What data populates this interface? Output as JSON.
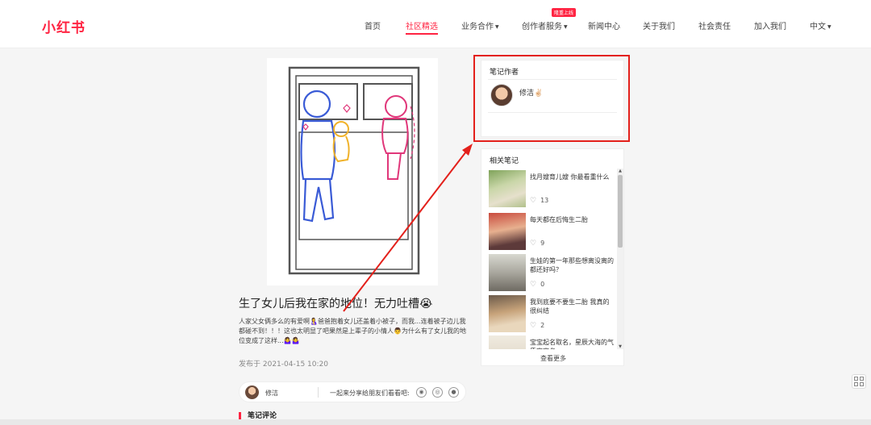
{
  "header": {
    "logo": "小红书",
    "nav": [
      {
        "label": "首页",
        "caret": false,
        "active": false
      },
      {
        "label": "社区精选",
        "caret": false,
        "active": true
      },
      {
        "label": "业务合作",
        "caret": true,
        "active": false
      },
      {
        "label": "创作者服务",
        "caret": true,
        "active": false
      },
      {
        "label": "新闻中心",
        "caret": false,
        "active": false
      },
      {
        "label": "关于我们",
        "caret": false,
        "active": false
      },
      {
        "label": "社会责任",
        "caret": false,
        "active": false
      },
      {
        "label": "加入我们",
        "caret": false,
        "active": false
      },
      {
        "label": "中文",
        "caret": true,
        "active": false
      }
    ],
    "badge": "隆重上线",
    "accent_color": "#ff2442"
  },
  "post": {
    "title": "生了女儿后我在家的地位！无力吐槽😭",
    "body": "人家父女俩多么的有爱啊🤱爸爸抱着女儿还盖着小被子，而我...连着被子边儿我都碰不到！！！这也太明显了吧果然是上辈子的小情人👨为什么有了女儿我的地位变成了这样...🤷‍♀️🤷‍♀️",
    "date": "发布于 2021-04-15 10:20",
    "share_author": "修洁",
    "share_text": "一起来分享给朋友们看看吧:",
    "share_icons": [
      "wechat-icon",
      "weibo-icon",
      "qq-icon"
    ],
    "comments_title": "笔记评论"
  },
  "author_card": {
    "title": "笔记作者",
    "name": "修洁✌🏻"
  },
  "related": {
    "title": "相关笔记",
    "items": [
      {
        "text": "找月嫂育儿嫂 你最看重什么",
        "likes": "13"
      },
      {
        "text": "每天都在后悔生二胎",
        "likes": "9"
      },
      {
        "text": "生娃的第一年那些想离没离的都还好吗？",
        "likes": "0"
      },
      {
        "text": "我到底要不要生二胎 我真的很纠结",
        "likes": "2"
      },
      {
        "text": "宝宝起名取名，星辰大海的气质宝宝名",
        "likes": ""
      }
    ],
    "see_more": "查看更多"
  },
  "annotation_color": "#e3201b"
}
